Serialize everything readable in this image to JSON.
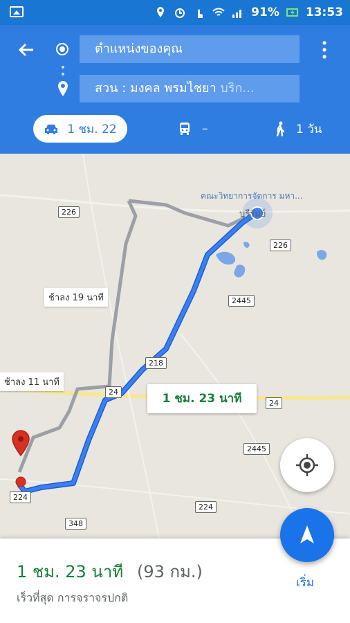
{
  "status_bar": {
    "battery": "91%",
    "time": "13:53"
  },
  "search": {
    "origin": "ตำแหน่งของคุณ",
    "destination_main": "สวน : มงคล พรมไชยา",
    "destination_more": " บริก..."
  },
  "modes": {
    "drive": "1 ชม. 22",
    "transit": "–",
    "walk": "1 วัน"
  },
  "map": {
    "callout_eta": "1 ชม. 23 นาที",
    "alt_route_1": "ช้าลง 19 นาที",
    "alt_route_2": "ช้าลง 11 นาที",
    "poi_label": "คณะวิทยาการจัดการ มหา...",
    "town_label": "บุรีรัมย์",
    "road_226_a": "226",
    "road_226_b": "226",
    "road_2445_a": "2445",
    "road_2445_b": "2445",
    "road_218": "218",
    "road_24_a": "24",
    "road_24_b": "24",
    "road_224_a": "224",
    "road_224_b": "224",
    "road_348": "348"
  },
  "summary": {
    "eta": "1 ชม. 23 นาที",
    "distance": "(93 กม.)",
    "subtitle": "เร็วที่สุด การจราจรปกติ",
    "start_label": "เริ่ม"
  },
  "icons": {
    "back": "back-arrow-icon",
    "origin": "origin-dot-icon",
    "destination": "destination-pin-icon",
    "more": "more-vert-icon",
    "car": "car-icon",
    "bus": "bus-icon",
    "walk": "walk-icon",
    "my_location": "my-location-icon",
    "navigation": "navigation-icon"
  },
  "colors": {
    "header": "#2f7de1",
    "route_primary": "#3d7ff0",
    "route_alt": "#9aa0a6",
    "eta_green": "#188038"
  }
}
